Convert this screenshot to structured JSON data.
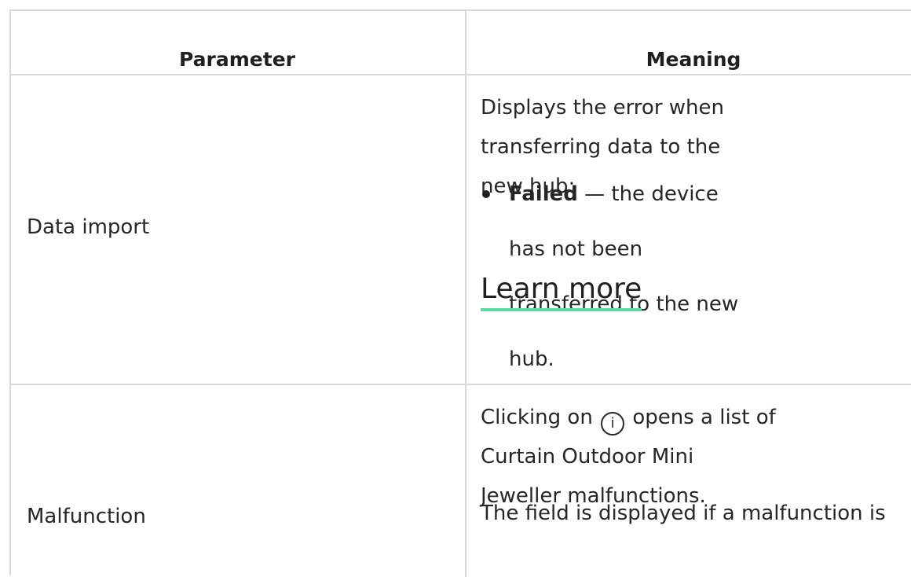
{
  "table": {
    "headers": {
      "parameter": "Parameter",
      "meaning": "Meaning"
    },
    "rows": [
      {
        "parameter": "Data import",
        "meaning_intro": "Displays the error when transferring data to the new hub:",
        "bullet_bold": "Failed",
        "bullet_rest": " — the device has not been transferred to the new hub.",
        "link_label": "Learn more"
      },
      {
        "parameter": "Malfunction",
        "meaning_part1": "Clicking on",
        "icon_glyph": "i",
        "meaning_part2": "opens a list of Curtain Outdoor Mini Jeweller malfunctions.",
        "meaning_note": "The field is displayed if a malfunction is"
      }
    ]
  },
  "icons": {
    "info": "info-circle-icon"
  },
  "colors": {
    "link_underline": "#5ed9a4",
    "border": "#d9d9d9"
  }
}
